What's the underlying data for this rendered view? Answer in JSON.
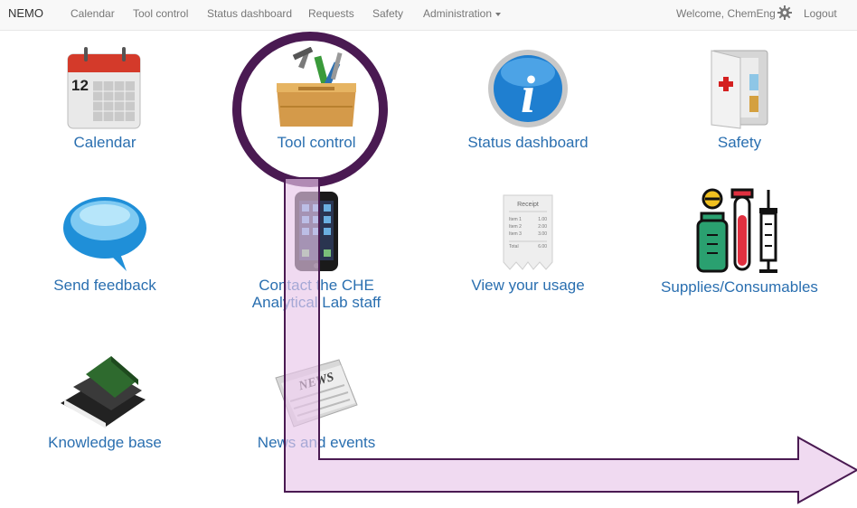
{
  "nav": {
    "brand": "NEMO",
    "items": [
      "Calendar",
      "Tool control",
      "Status dashboard",
      "Requests",
      "Safety",
      "Administration"
    ],
    "welcome": "Welcome, ChemEng",
    "logout": "Logout"
  },
  "tiles": {
    "calendar": {
      "label": "Calendar",
      "icon_text": "12"
    },
    "tool_control": {
      "label": "Tool control"
    },
    "status_dashboard": {
      "label": "Status dashboard",
      "icon_text": "i"
    },
    "safety": {
      "label": "Safety"
    },
    "send_feedback": {
      "label": "Send feedback"
    },
    "contact": {
      "label_line1": "Contact the CHE",
      "label_line2": "Analytical Lab staff"
    },
    "usage": {
      "label": "View your usage",
      "receipt_title": "Receipt",
      "receipt_items": [
        "Item 1",
        "Item 2",
        "Item 3",
        "Total"
      ],
      "receipt_values": [
        "1.00",
        "2.00",
        "3.00",
        "6.00"
      ]
    },
    "supplies": {
      "label": "Supplies/Consumables"
    },
    "knowledge": {
      "label": "Knowledge base"
    },
    "news": {
      "label": "News and events",
      "icon_text": "NEWS"
    }
  },
  "colors": {
    "link": "#2a6fb0",
    "annotation_ring": "#4a1a52",
    "annotation_arrow_fill": "#e8c6ea"
  }
}
